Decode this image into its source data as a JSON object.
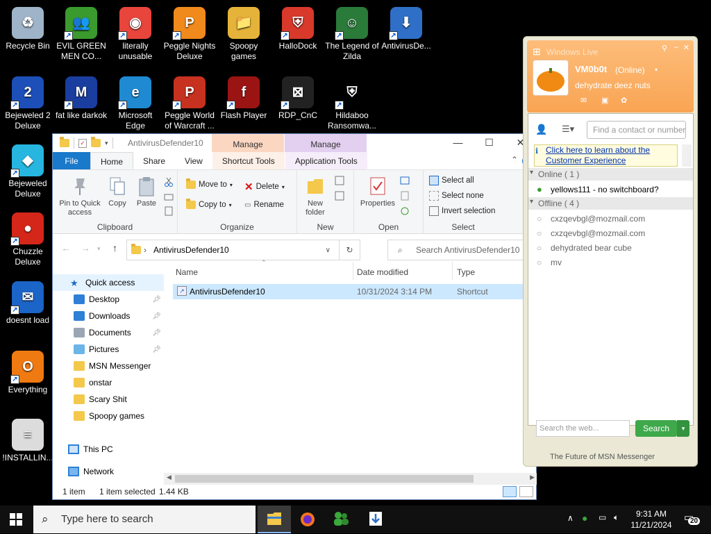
{
  "desktop": {
    "icons": [
      {
        "label": "Recycle Bin",
        "icon": "recycle-bin-icon",
        "color": "#9fb4c8"
      },
      {
        "label": "EVIL GREEN MEN CO...",
        "icon": "messenger-buddies-icon",
        "color": "#3a9a2e"
      },
      {
        "label": "literally unusable",
        "icon": "chrome-icon",
        "color": "#e8453c"
      },
      {
        "label": "Peggle Nights Deluxe",
        "icon": "peggle-icon",
        "color": "#f08a1c"
      },
      {
        "label": "Spoopy games",
        "icon": "folder-icon",
        "color": "#e6b33a"
      },
      {
        "label": "HalloDock",
        "icon": "windows-shield-icon",
        "color": "#d8392b"
      },
      {
        "label": "The Legend of Zilda",
        "icon": "game-character-icon",
        "color": "#2a7a3a"
      },
      {
        "label": "AntivirusDe...",
        "icon": "download-file-icon",
        "color": "#2f6fc7"
      },
      {
        "label": "Bejeweled 2 Deluxe",
        "icon": "bejeweled-2-icon",
        "color": "#1d4fb8"
      },
      {
        "label": "fat like darkok",
        "icon": "mpl-icon",
        "color": "#1a3ea0"
      },
      {
        "label": "Microsoft Edge",
        "icon": "edge-icon",
        "color": "#1f8ad2"
      },
      {
        "label": "Peggle World of Warcraft ...",
        "icon": "peggle-wow-icon",
        "color": "#c7311f"
      },
      {
        "label": "Flash Player",
        "icon": "flash-player-icon",
        "color": "#9b1414"
      },
      {
        "label": "RDP_CnC",
        "icon": "rdp-icon",
        "color": "#222222"
      },
      {
        "label": "Hildaboo Ransomwa...",
        "icon": "yashma-shield-icon",
        "color": "#000000"
      },
      {
        "label": "Bejeweled Deluxe",
        "icon": "diamond-icon",
        "color": "#27b6e0"
      },
      {
        "label": "Chuzzle Deluxe",
        "icon": "chuzzle-icon",
        "color": "#d4271a"
      },
      {
        "label": "doesnt load",
        "icon": "thunderbird-icon",
        "color": "#1b64c8"
      },
      {
        "label": "Everything",
        "icon": "magnifier-icon",
        "color": "#f07a12"
      },
      {
        "label": "!INSTALLIN...",
        "icon": "text-file-icon",
        "color": "#dcdcdc"
      }
    ]
  },
  "explorer": {
    "title": "AntivirusDefender10",
    "context_headers": [
      "Manage",
      "Manage"
    ],
    "tabs": [
      "File",
      "Home",
      "Share",
      "View",
      "Shortcut Tools",
      "Application Tools"
    ],
    "ribbon": {
      "clipboard": {
        "pin": "Pin to Quick access",
        "copy": "Copy",
        "paste": "Paste",
        "label": "Clipboard"
      },
      "organize": {
        "move_to": "Move to",
        "copy_to": "Copy to",
        "delete": "Delete",
        "rename": "Rename",
        "label": "Organize"
      },
      "new": {
        "new_folder": "New folder",
        "label": "New"
      },
      "open": {
        "properties": "Properties",
        "label": "Open"
      },
      "select": {
        "select_all": "Select all",
        "select_none": "Select none",
        "invert": "Invert selection",
        "label": "Select"
      }
    },
    "address": "AntivirusDefender10",
    "search_placeholder": "Search AntivirusDefender10",
    "nav": {
      "quick_access": "Quick access",
      "items": [
        "Desktop",
        "Downloads",
        "Documents",
        "Pictures",
        "MSN Messenger",
        "onstar",
        "Scary Shit",
        "Spoopy games"
      ],
      "this_pc": "This PC",
      "network": "Network"
    },
    "columns": {
      "name": "Name",
      "date": "Date modified",
      "type": "Type"
    },
    "files": [
      {
        "name": "AntivirusDefender10",
        "date": "10/31/2024 3:14 PM",
        "type": "Shortcut"
      }
    ],
    "status": {
      "count": "1 item",
      "selected": "1 item selected",
      "size": "1.44 KB"
    }
  },
  "messenger": {
    "title": "Windows Live",
    "username": "VM0b0t",
    "status": "(Online)",
    "message": "dehydrate deez nuts",
    "find_placeholder": "Find a contact or number",
    "ad_text": "Click here to learn about the Customer Experience",
    "online_header": "Online ( 1 )",
    "online_contacts": [
      "yellows111 - no switchboard?"
    ],
    "offline_header": "Offline ( 4 )",
    "offline_contacts": [
      "cxzqevbgl@mozmail.com",
      "cxzqevbgl@mozmail.com",
      "dehydrated bear cube",
      "mv"
    ],
    "search_placeholder": "Search the web...",
    "search_button": "Search",
    "footer": "The Future of MSN Messenger",
    "accent": "#f9a453"
  },
  "taskbar": {
    "search_placeholder": "Type here to search",
    "time": "9:31 AM",
    "date": "11/21/2024",
    "notifications": "20"
  }
}
